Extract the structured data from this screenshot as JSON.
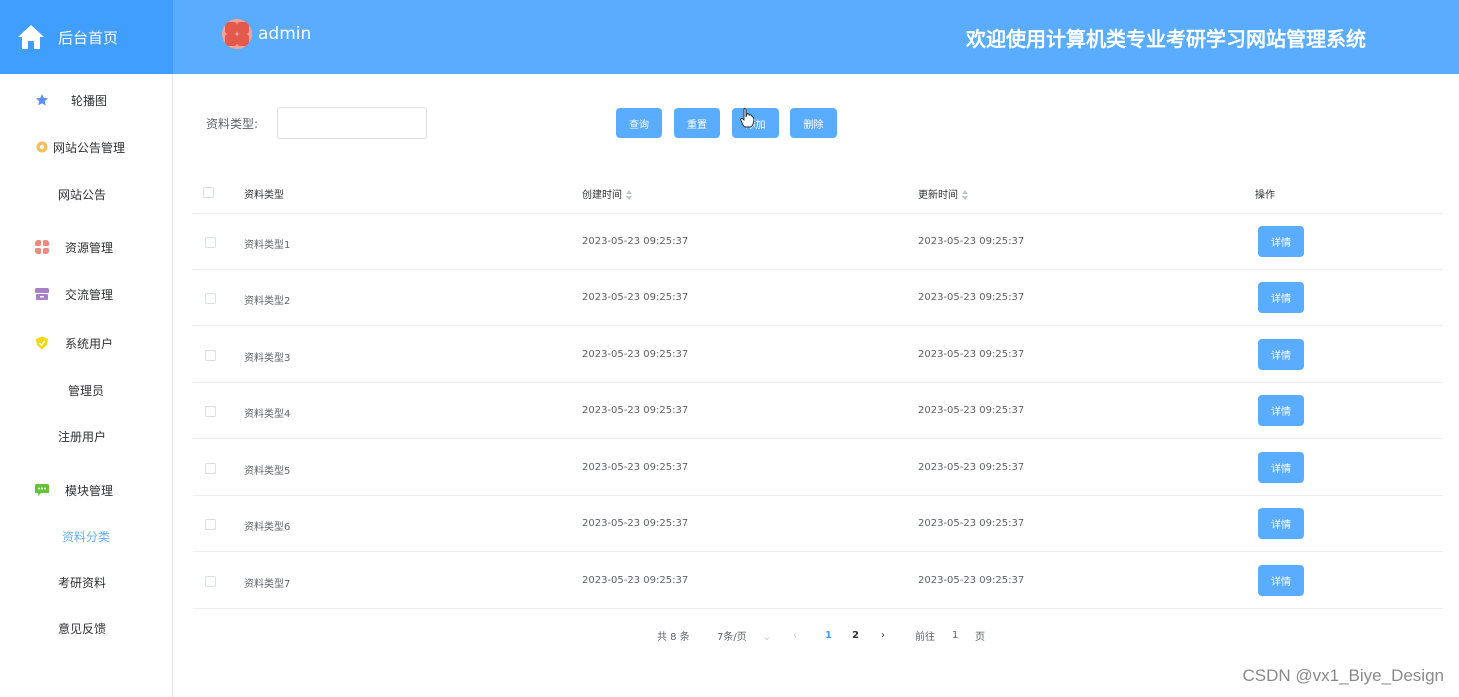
{
  "brand": {
    "label": "后台首页"
  },
  "header": {
    "user": "admin",
    "title": "欢迎使用计算机类专业考研学习网站管理系统"
  },
  "sidebar": {
    "items": [
      {
        "label": "轮播图",
        "icon": "star-icon",
        "color": "#5b8ff9"
      },
      {
        "label": "网站公告管理",
        "icon": "gear-icon",
        "color": "#f6bd60"
      },
      {
        "label": "网站公告",
        "sub": true
      },
      {
        "label": "资源管理",
        "icon": "grid-icon",
        "color": "#f08a7e"
      },
      {
        "label": "交流管理",
        "icon": "box-icon",
        "color": "#a97fc8"
      },
      {
        "label": "系统用户",
        "icon": "shield-icon",
        "color": "#f5d90a"
      },
      {
        "label": "管理员",
        "sub": true
      },
      {
        "label": "注册用户",
        "sub": true
      },
      {
        "label": "模块管理",
        "icon": "chat-icon",
        "color": "#67c23a"
      },
      {
        "label": "资料分类",
        "sub": true,
        "active": true
      },
      {
        "label": "考研资料",
        "sub": true
      },
      {
        "label": "意见反馈",
        "sub": true
      }
    ]
  },
  "search": {
    "label": "资料类型:",
    "value": ""
  },
  "buttons": {
    "query": "查询",
    "reset": "重置",
    "add": "添加",
    "delete": "删除"
  },
  "table": {
    "headers": {
      "type": "资料类型",
      "created": "创建时间",
      "updated": "更新时间",
      "actions": "操作"
    },
    "detail_label": "详情",
    "rows": [
      {
        "type": "资料类型1",
        "created": "2023-05-23 09:25:37",
        "updated": "2023-05-23 09:25:37"
      },
      {
        "type": "资料类型2",
        "created": "2023-05-23 09:25:37",
        "updated": "2023-05-23 09:25:37"
      },
      {
        "type": "资料类型3",
        "created": "2023-05-23 09:25:37",
        "updated": "2023-05-23 09:25:37"
      },
      {
        "type": "资料类型4",
        "created": "2023-05-23 09:25:37",
        "updated": "2023-05-23 09:25:37"
      },
      {
        "type": "资料类型5",
        "created": "2023-05-23 09:25:37",
        "updated": "2023-05-23 09:25:37"
      },
      {
        "type": "资料类型6",
        "created": "2023-05-23 09:25:37",
        "updated": "2023-05-23 09:25:37"
      },
      {
        "type": "资料类型7",
        "created": "2023-05-23 09:25:37",
        "updated": "2023-05-23 09:25:37"
      }
    ]
  },
  "pagination": {
    "total": "共 8 条",
    "page_size": "7条/页",
    "pages": [
      "1",
      "2"
    ],
    "current": "1",
    "goto_prefix": "前往",
    "goto_value": "1",
    "goto_suffix": "页"
  },
  "watermark": "CSDN @vx1_Biye_Design"
}
